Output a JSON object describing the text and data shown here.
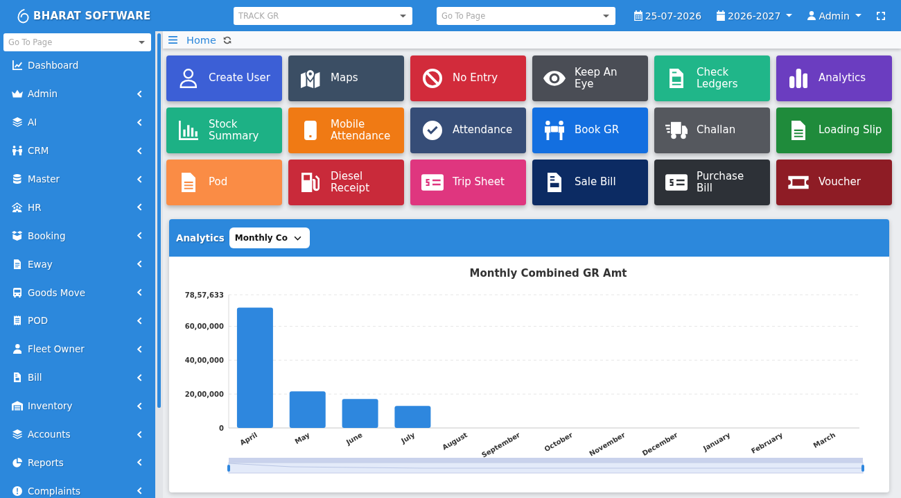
{
  "header": {
    "brand": "BHARAT SOFTWARE",
    "track_select": {
      "placeholder": "TRACK GR"
    },
    "page_select": {
      "placeholder": "Go To Page"
    },
    "date": "25-07-2026",
    "financial_year": "2026-2027",
    "user": "Admin"
  },
  "sidebar": {
    "search": {
      "placeholder": "Go To Page"
    },
    "items": [
      {
        "label": "Dashboard",
        "kind": "link"
      },
      {
        "label": "Admin",
        "kind": "menu"
      },
      {
        "label": "AI",
        "kind": "menu"
      },
      {
        "label": "CRM",
        "kind": "menu"
      },
      {
        "label": "Master",
        "kind": "menu"
      },
      {
        "label": "HR",
        "kind": "menu"
      },
      {
        "label": "Booking",
        "kind": "menu"
      },
      {
        "label": "Eway",
        "kind": "menu"
      },
      {
        "label": "Goods Move",
        "kind": "menu"
      },
      {
        "label": "POD",
        "kind": "menu"
      },
      {
        "label": "Fleet Owner",
        "kind": "menu"
      },
      {
        "label": "Bill",
        "kind": "menu"
      },
      {
        "label": "Inventory",
        "kind": "menu"
      },
      {
        "label": "Accounts",
        "kind": "menu"
      },
      {
        "label": "Reports",
        "kind": "menu"
      },
      {
        "label": "Complaints",
        "kind": "menu"
      }
    ]
  },
  "breadcrumb": {
    "label": "Home"
  },
  "tiles": [
    {
      "label": "Create User",
      "color": "#3c5fd6"
    },
    {
      "label": "Maps",
      "color": "#3b4e64"
    },
    {
      "label": "No Entry",
      "color": "#d22b3b"
    },
    {
      "label": "Keep An\nEye",
      "color": "#4a4d55"
    },
    {
      "label": "Check\nLedgers",
      "color": "#20b689"
    },
    {
      "label": "Analytics",
      "color": "#6b3dc0"
    },
    {
      "label": "Stock\nSummary",
      "color": "#1db185"
    },
    {
      "label": "Mobile\nAttendance",
      "color": "#f07a14"
    },
    {
      "label": "Attendance",
      "color": "#364d77"
    },
    {
      "label": "Book GR",
      "color": "#136fe0"
    },
    {
      "label": "Challan",
      "color": "#55585e"
    },
    {
      "label": "Loading Slip",
      "color": "#1f8b3b"
    },
    {
      "label": "Pod",
      "color": "#fa8c45"
    },
    {
      "label": "Diesel\nReceipt",
      "color": "#c92a3a"
    },
    {
      "label": "Trip Sheet",
      "color": "#df367f"
    },
    {
      "label": "Sale Bill",
      "color": "#0c2b63"
    },
    {
      "label": "Purchase\nBill",
      "color": "#2d3137"
    },
    {
      "label": "Voucher",
      "color": "#8e1c25"
    }
  ],
  "analytics": {
    "title": "Analytics",
    "select": {
      "value": "Monthly Co"
    },
    "chart_data": {
      "type": "bar",
      "title": "Monthly Combined GR Amt",
      "categories": [
        "April",
        "May",
        "June",
        "July",
        "August",
        "September",
        "October",
        "November",
        "December",
        "January",
        "February",
        "March"
      ],
      "values": [
        7100000,
        2160000,
        1710000,
        1300000,
        0,
        0,
        0,
        0,
        0,
        0,
        0,
        0
      ],
      "ylim": [
        0,
        7857633
      ],
      "yticks": [
        {
          "value": 0,
          "label": "0"
        },
        {
          "value": 2000000,
          "label": "20,00,000"
        },
        {
          "value": 4000000,
          "label": "40,00,000"
        },
        {
          "value": 6000000,
          "label": "60,00,000"
        },
        {
          "value": 7857633,
          "label": "78,57,633"
        }
      ],
      "grid": true
    }
  }
}
